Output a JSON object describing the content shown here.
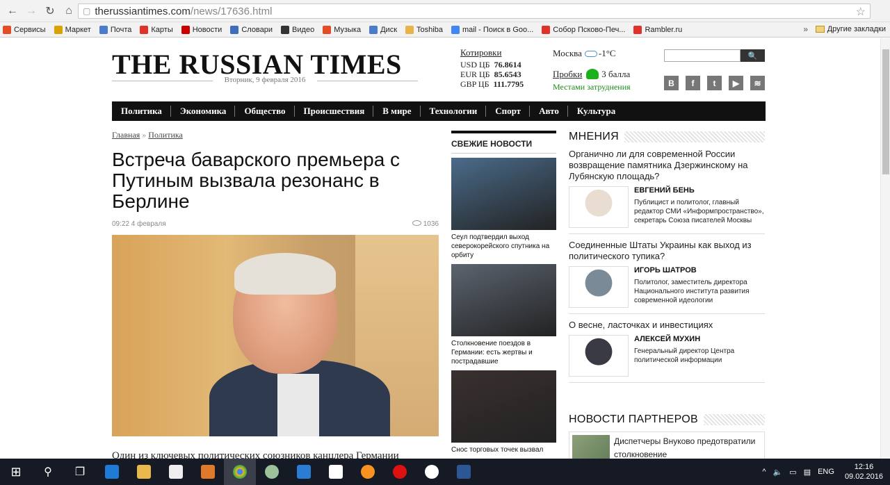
{
  "browser": {
    "url_host": "therussiantimes.com",
    "url_path": "/news/17636.html",
    "bookmarks": [
      {
        "label": "Сервисы",
        "color": "#e34c26"
      },
      {
        "label": "Маркет",
        "color": "#d8a200"
      },
      {
        "label": "Почта",
        "color": "#4a7cc9"
      },
      {
        "label": "Карты",
        "color": "#e0312b"
      },
      {
        "label": "Новости",
        "color": "#c00"
      },
      {
        "label": "Словари",
        "color": "#3c6ebd"
      },
      {
        "label": "Видео",
        "color": "#333"
      },
      {
        "label": "Музыка",
        "color": "#e34c26"
      },
      {
        "label": "Диск",
        "color": "#4a7cc9"
      },
      {
        "label": "Toshiba",
        "color": "#e8b44a"
      },
      {
        "label": "mail - Поиск в Goo...",
        "color": "#4285f4"
      },
      {
        "label": "Собор Псково-Печ...",
        "color": "#e0312b"
      },
      {
        "label": "Rambler.ru",
        "color": "#e0312b"
      }
    ],
    "more": "»",
    "other_bookmarks": "Другие закладки"
  },
  "site": {
    "logo": "THE RUSSIAN TIMES",
    "date": "Вторник, 9 февраля 2016",
    "quotes_title": "Котировки",
    "quotes": [
      {
        "label": "USD ЦБ",
        "value": "76.8614"
      },
      {
        "label": "EUR ЦБ",
        "value": "85.6543"
      },
      {
        "label": "GBP ЦБ",
        "value": "111.7795"
      }
    ],
    "weather_city": "Москва",
    "weather_temp": "-1°C",
    "traffic_label": "Пробки",
    "traffic_value": "3 балла",
    "traffic_note": "Местами затруднения",
    "search_btn": "🔍",
    "social": [
      "В",
      "f",
      "t",
      "▶",
      "≋"
    ],
    "nav": [
      "Политика",
      "Экономика",
      "Общество",
      "Происшествия",
      "В мире",
      "Технологии",
      "Спорт",
      "Авто",
      "Культура"
    ]
  },
  "article": {
    "crumb_home": "Главная",
    "crumb_sep": "»",
    "crumb_section": "Политика",
    "title": "Встреча баварского премьера с Путиным вызвала резонанс в Берлине",
    "time": "09:22 4 февраля",
    "views": "1036",
    "lead": "Один из ключевых политических союзников канцлера Германии"
  },
  "fresh": {
    "title": "СВЕЖИЕ НОВОСТИ",
    "items": [
      {
        "caption": "Сеул подтвердил выход северокорейского спутника на орбиту",
        "color": "#4a6b8a"
      },
      {
        "caption": "Столкновение поездов в Германии: есть жертвы и пострадавшие",
        "color": "#5c6470"
      },
      {
        "caption": "Снос торговых точек вызвал",
        "color": "#3a3030"
      }
    ]
  },
  "opinions": {
    "title": "МНЕНИЯ",
    "items": [
      {
        "question": "Органично ли для современной России возвращение памятника Дзержинскому на Лубянскую площадь?",
        "name": "ЕВГЕНИЙ БЕНЬ",
        "bio": "Публицист и политолог, главный редактор СМИ «Информпространство», секретарь Союза писателей Москвы",
        "photo": "#e9ddd2"
      },
      {
        "question": "Соединенные Штаты Украины как выход из политического тупика?",
        "name": "ИГОРЬ ШАТРОВ",
        "bio": "Политолог, заместитель директора Национального института развития современной идеологии",
        "photo": "#7a8a96"
      },
      {
        "question": "О весне, ласточках и инвестициях",
        "name": "АЛЕКСЕЙ МУХИН",
        "bio": "Генеральный директор Центра политической информации",
        "photo": "#3a3a44"
      }
    ]
  },
  "partners": {
    "title": "НОВОСТИ ПАРТНЕРОВ",
    "item": "Диспетчеры Внуково предотвратили столкновение"
  },
  "taskbar": {
    "lang": "ENG",
    "time": "12:16",
    "date": "09.02.2016"
  }
}
